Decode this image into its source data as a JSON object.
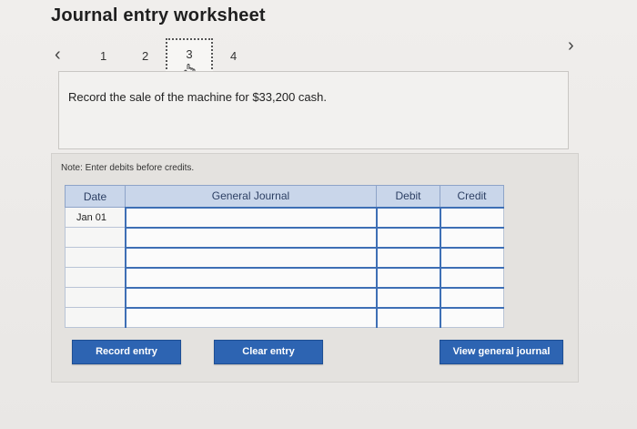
{
  "worksheet": {
    "title": "Journal entry worksheet"
  },
  "navigation": {
    "steps": [
      "1",
      "2",
      "3",
      "4"
    ],
    "current_step": "3"
  },
  "instruction": {
    "text": "Record the sale of the machine for $33,200 cash."
  },
  "note": {
    "text": "Note: Enter debits before credits."
  },
  "journal": {
    "headers": {
      "date": "Date",
      "general_journal": "General Journal",
      "debit": "Debit",
      "credit": "Credit"
    },
    "rows": [
      {
        "date": "Jan 01",
        "account": "",
        "debit": "",
        "credit": ""
      },
      {
        "date": "",
        "account": "",
        "debit": "",
        "credit": ""
      },
      {
        "date": "",
        "account": "",
        "debit": "",
        "credit": ""
      },
      {
        "date": "",
        "account": "",
        "debit": "",
        "credit": ""
      },
      {
        "date": "",
        "account": "",
        "debit": "",
        "credit": ""
      },
      {
        "date": "",
        "account": "",
        "debit": "",
        "credit": ""
      }
    ]
  },
  "buttons": {
    "record": "Record entry",
    "clear": "Clear entry",
    "view": "View general journal"
  },
  "colors": {
    "accent": "#2d64b2",
    "header_bg": "#c9d6ea"
  },
  "icons": {
    "prev": "chevron-left-icon",
    "next": "chevron-right-icon",
    "pointer": "hand-pointer-icon"
  }
}
